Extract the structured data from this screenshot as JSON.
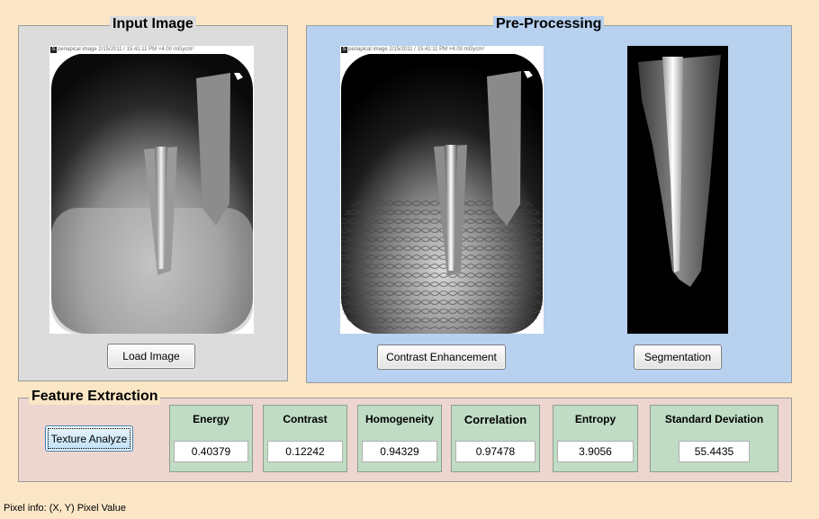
{
  "panels": {
    "input": {
      "title": "Input Image",
      "load_button": "Load Image"
    },
    "preprocessing": {
      "title": "Pre-Processing",
      "contrast_button": "Contrast Enhancement",
      "segmentation_button": "Segmentation"
    },
    "features": {
      "title": "Feature Extraction",
      "analyze_button": "Texture Analyze",
      "items": [
        {
          "label": "Energy",
          "value": "0.40379"
        },
        {
          "label": "Contrast",
          "value": "0.12242"
        },
        {
          "label": "Homogeneity",
          "value": "0.94329"
        },
        {
          "label": "Correlation",
          "value": "0.97478"
        },
        {
          "label": "Entropy",
          "value": "3.9056"
        },
        {
          "label": "Standard Deviation",
          "value": "55.4435"
        }
      ]
    }
  },
  "image_badge": "S",
  "image_caption": "periapical image 2/15/2011 / 15:41:11 PM  ×4.00 mGycm²",
  "status_bar": "Pixel info: (X, Y)  Pixel Value",
  "colors": {
    "background": "#fbe7c6",
    "input_panel": "#dcdcdc",
    "preprocessing_panel": "#b7d1ef",
    "feature_panel": "#ecd6cf",
    "feature_box": "#c0dcc4"
  }
}
